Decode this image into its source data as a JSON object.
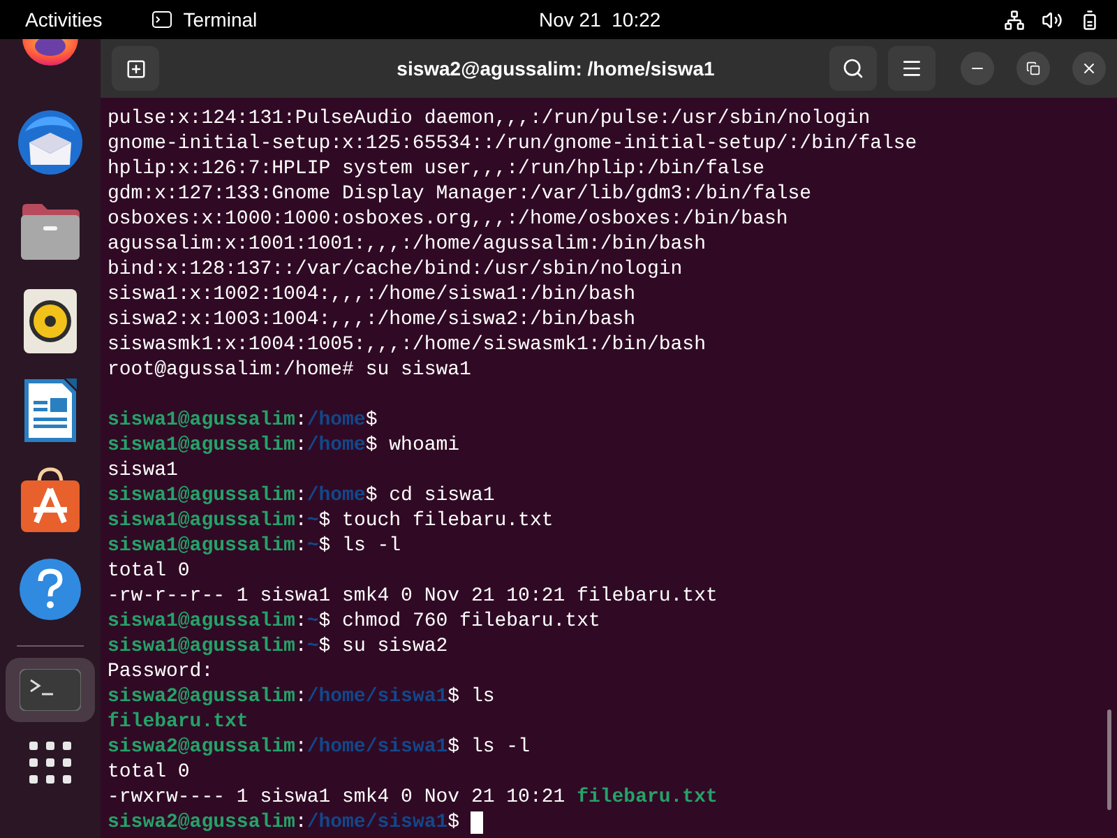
{
  "top_bar": {
    "activities": "Activities",
    "app_name": "Terminal",
    "clock": "Nov 21  10:22"
  },
  "dock": {
    "items": [
      {
        "kind": "firefox",
        "running": false
      },
      {
        "kind": "thunderbird",
        "running": false
      },
      {
        "kind": "files",
        "running": false
      },
      {
        "kind": "rhythmbox",
        "running": false
      },
      {
        "kind": "writer",
        "running": false
      },
      {
        "kind": "appcenter",
        "running": false
      },
      {
        "kind": "help",
        "running": false
      },
      {
        "kind": "terminal",
        "running": true
      }
    ]
  },
  "window": {
    "title": "siswa2@agussalim: /home/siswa1"
  },
  "terminal": {
    "lines": [
      [
        {
          "kind": "plain",
          "text": "pulse:x:124:131:PulseAudio daemon,,,:/run/pulse:/usr/sbin/nologin"
        }
      ],
      [
        {
          "kind": "plain",
          "text": "gnome-initial-setup:x:125:65534::/run/gnome-initial-setup/:/bin/false"
        }
      ],
      [
        {
          "kind": "plain",
          "text": "hplip:x:126:7:HPLIP system user,,,:/run/hplip:/bin/false"
        }
      ],
      [
        {
          "kind": "plain",
          "text": "gdm:x:127:133:Gnome Display Manager:/var/lib/gdm3:/bin/false"
        }
      ],
      [
        {
          "kind": "plain",
          "text": "osboxes:x:1000:1000:osboxes.org,,,:/home/osboxes:/bin/bash"
        }
      ],
      [
        {
          "kind": "plain",
          "text": "agussalim:x:1001:1001:,,,:/home/agussalim:/bin/bash"
        }
      ],
      [
        {
          "kind": "plain",
          "text": "bind:x:128:137::/var/cache/bind:/usr/sbin/nologin"
        }
      ],
      [
        {
          "kind": "plain",
          "text": "siswa1:x:1002:1004:,,,:/home/siswa1:/bin/bash"
        }
      ],
      [
        {
          "kind": "plain",
          "text": "siswa2:x:1003:1004:,,,:/home/siswa2:/bin/bash"
        }
      ],
      [
        {
          "kind": "plain",
          "text": "siswasmk1:x:1004:1005:,,,:/home/siswasmk1:/bin/bash"
        }
      ],
      [
        {
          "kind": "plain",
          "text": "root@agussalim:/home# su siswa1"
        }
      ],
      [
        {
          "kind": "blank"
        }
      ],
      [
        {
          "kind": "user",
          "text": "siswa1@agussalim"
        },
        {
          "kind": "plain",
          "text": ":"
        },
        {
          "kind": "path",
          "text": "/home"
        },
        {
          "kind": "plain",
          "text": "$"
        }
      ],
      [
        {
          "kind": "user",
          "text": "siswa1@agussalim"
        },
        {
          "kind": "plain",
          "text": ":"
        },
        {
          "kind": "path",
          "text": "/home"
        },
        {
          "kind": "plain",
          "text": "$ whoami"
        }
      ],
      [
        {
          "kind": "plain",
          "text": "siswa1"
        }
      ],
      [
        {
          "kind": "user",
          "text": "siswa1@agussalim"
        },
        {
          "kind": "plain",
          "text": ":"
        },
        {
          "kind": "path",
          "text": "/home"
        },
        {
          "kind": "plain",
          "text": "$ cd siswa1"
        }
      ],
      [
        {
          "kind": "user",
          "text": "siswa1@agussalim"
        },
        {
          "kind": "plain",
          "text": ":"
        },
        {
          "kind": "path",
          "text": "~"
        },
        {
          "kind": "plain",
          "text": "$ touch filebaru.txt"
        }
      ],
      [
        {
          "kind": "user",
          "text": "siswa1@agussalim"
        },
        {
          "kind": "plain",
          "text": ":"
        },
        {
          "kind": "path",
          "text": "~"
        },
        {
          "kind": "plain",
          "text": "$ ls -l"
        }
      ],
      [
        {
          "kind": "plain",
          "text": "total 0"
        }
      ],
      [
        {
          "kind": "plain",
          "text": "-rw-r--r-- 1 siswa1 smk4 0 Nov 21 10:21 filebaru.txt"
        }
      ],
      [
        {
          "kind": "user",
          "text": "siswa1@agussalim"
        },
        {
          "kind": "plain",
          "text": ":"
        },
        {
          "kind": "path",
          "text": "~"
        },
        {
          "kind": "plain",
          "text": "$ chmod 760 filebaru.txt"
        }
      ],
      [
        {
          "kind": "user",
          "text": "siswa1@agussalim"
        },
        {
          "kind": "plain",
          "text": ":"
        },
        {
          "kind": "path",
          "text": "~"
        },
        {
          "kind": "plain",
          "text": "$ su siswa2"
        }
      ],
      [
        {
          "kind": "plain",
          "text": "Password:"
        }
      ],
      [
        {
          "kind": "user",
          "text": "siswa2@agussalim"
        },
        {
          "kind": "plain",
          "text": ":"
        },
        {
          "kind": "path",
          "text": "/home/siswa1"
        },
        {
          "kind": "plain",
          "text": "$ ls"
        }
      ],
      [
        {
          "kind": "exec",
          "text": "filebaru.txt"
        }
      ],
      [
        {
          "kind": "user",
          "text": "siswa2@agussalim"
        },
        {
          "kind": "plain",
          "text": ":"
        },
        {
          "kind": "path",
          "text": "/home/siswa1"
        },
        {
          "kind": "plain",
          "text": "$ ls -l"
        }
      ],
      [
        {
          "kind": "plain",
          "text": "total 0"
        }
      ],
      [
        {
          "kind": "plain",
          "text": "-rwxrw---- 1 siswa1 smk4 0 Nov 21 10:21 "
        },
        {
          "kind": "exec",
          "text": "filebaru.txt"
        }
      ],
      [
        {
          "kind": "user",
          "text": "siswa2@agussalim"
        },
        {
          "kind": "plain",
          "text": ":"
        },
        {
          "kind": "path",
          "text": "/home/siswa1"
        },
        {
          "kind": "plain",
          "text": "$ "
        }
      ]
    ],
    "cursor": true
  }
}
